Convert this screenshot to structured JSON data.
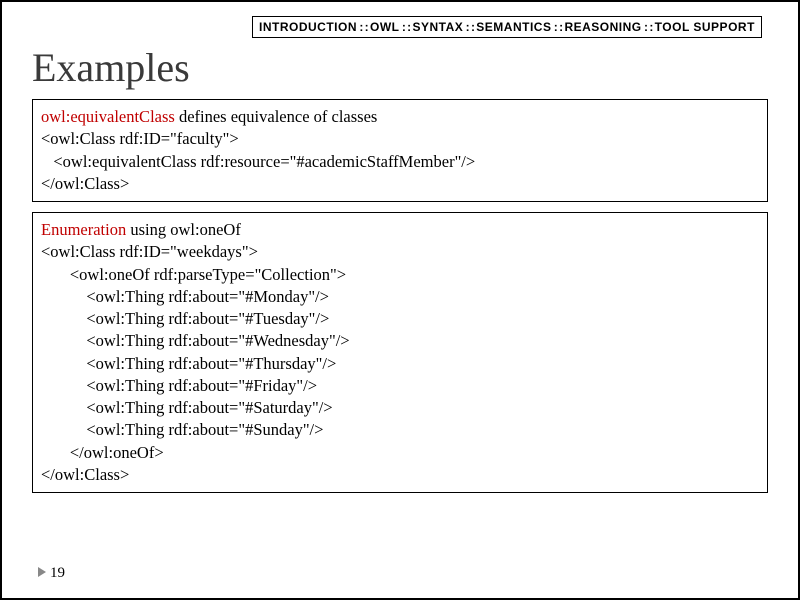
{
  "breadcrumb": {
    "items": [
      "INTRODUCTION",
      "OWL",
      "SYNTAX",
      "SEMANTICS",
      "REASONING",
      "TOOL SUPPORT"
    ],
    "sep": " : : "
  },
  "title": "Examples",
  "box1": {
    "lead_red": "owl:equivalentClass",
    "lead_rest": " defines equivalence of classes",
    "code": [
      "<owl:Class rdf:ID=\"faculty\">",
      "   <owl:equivalentClass rdf:resource=\"#academicStaffMember\"/>",
      "</owl:Class>"
    ]
  },
  "box2": {
    "lead_red": "Enumeration",
    "lead_rest": " using owl:oneOf",
    "code": [
      "<owl:Class rdf:ID=\"weekdays\">",
      "       <owl:oneOf rdf:parseType=\"Collection\">",
      "           <owl:Thing rdf:about=\"#Monday\"/>",
      "           <owl:Thing rdf:about=\"#Tuesday\"/>",
      "           <owl:Thing rdf:about=\"#Wednesday\"/>",
      "           <owl:Thing rdf:about=\"#Thursday\"/>",
      "           <owl:Thing rdf:about=\"#Friday\"/>",
      "           <owl:Thing rdf:about=\"#Saturday\"/>",
      "           <owl:Thing rdf:about=\"#Sunday\"/>",
      "       </owl:oneOf>",
      "</owl:Class>"
    ]
  },
  "page_number": "19"
}
